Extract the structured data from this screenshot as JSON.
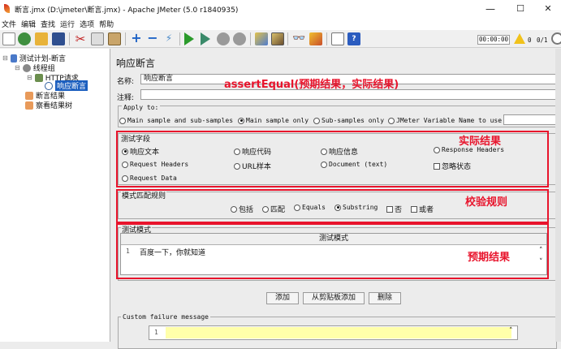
{
  "window": {
    "title": "断言.jmx (D:\\jmeter\\断言.jmx) - Apache JMeter (5.0 r1840935)",
    "min": "—",
    "max": "☐",
    "close": "✕"
  },
  "menu": [
    "文件",
    "编辑",
    "查找",
    "运行",
    "选项",
    "帮助"
  ],
  "toolbar": {
    "timer": "00:00:00",
    "warn_count": "0",
    "threads": "0/1"
  },
  "tree": {
    "plan": "测试计划-断言",
    "group": "线程组",
    "sampler": "HTTP请求",
    "assertion": "响应断言",
    "result1": "断言结果",
    "result2": "察看结果树"
  },
  "panel": {
    "title": "响应断言",
    "name_label": "名称:",
    "name_value": "响应断言",
    "comment_label": "注释:",
    "apply_to": "Apply to:",
    "apply_options": [
      "Main sample and sub-samples",
      "Main sample only",
      "Sub-samples only",
      "JMeter Variable Name to use"
    ],
    "field_label": "测试字段",
    "fields": [
      "响应文本",
      "响应代码",
      "响应信息",
      "Response Headers",
      "Request Headers",
      "URL样本",
      "Document (text)",
      "忽略状态",
      "Request Data"
    ],
    "rule_label": "模式匹配规则",
    "rules": [
      "包括",
      "匹配",
      "Equals",
      "Substring",
      "否",
      "或者"
    ],
    "pattern_label": "测试模式",
    "pattern_header": "测试模式",
    "pattern_row_no": "1",
    "pattern_value": "百度一下，你就知道",
    "buttons": [
      "添加",
      "从剪贴板添加",
      "删除"
    ],
    "custom_failure": "Custom failure message",
    "custom_row_no": "1"
  },
  "annotations": {
    "assert": "assertEqual(预期结果，实际结果)",
    "actual": "实际结果",
    "rule": "校验规则",
    "expected": "预期结果"
  },
  "colors": {
    "red": "#e8142c",
    "selection": "#1c5fbf",
    "highlight_input": "#ffffaa"
  }
}
